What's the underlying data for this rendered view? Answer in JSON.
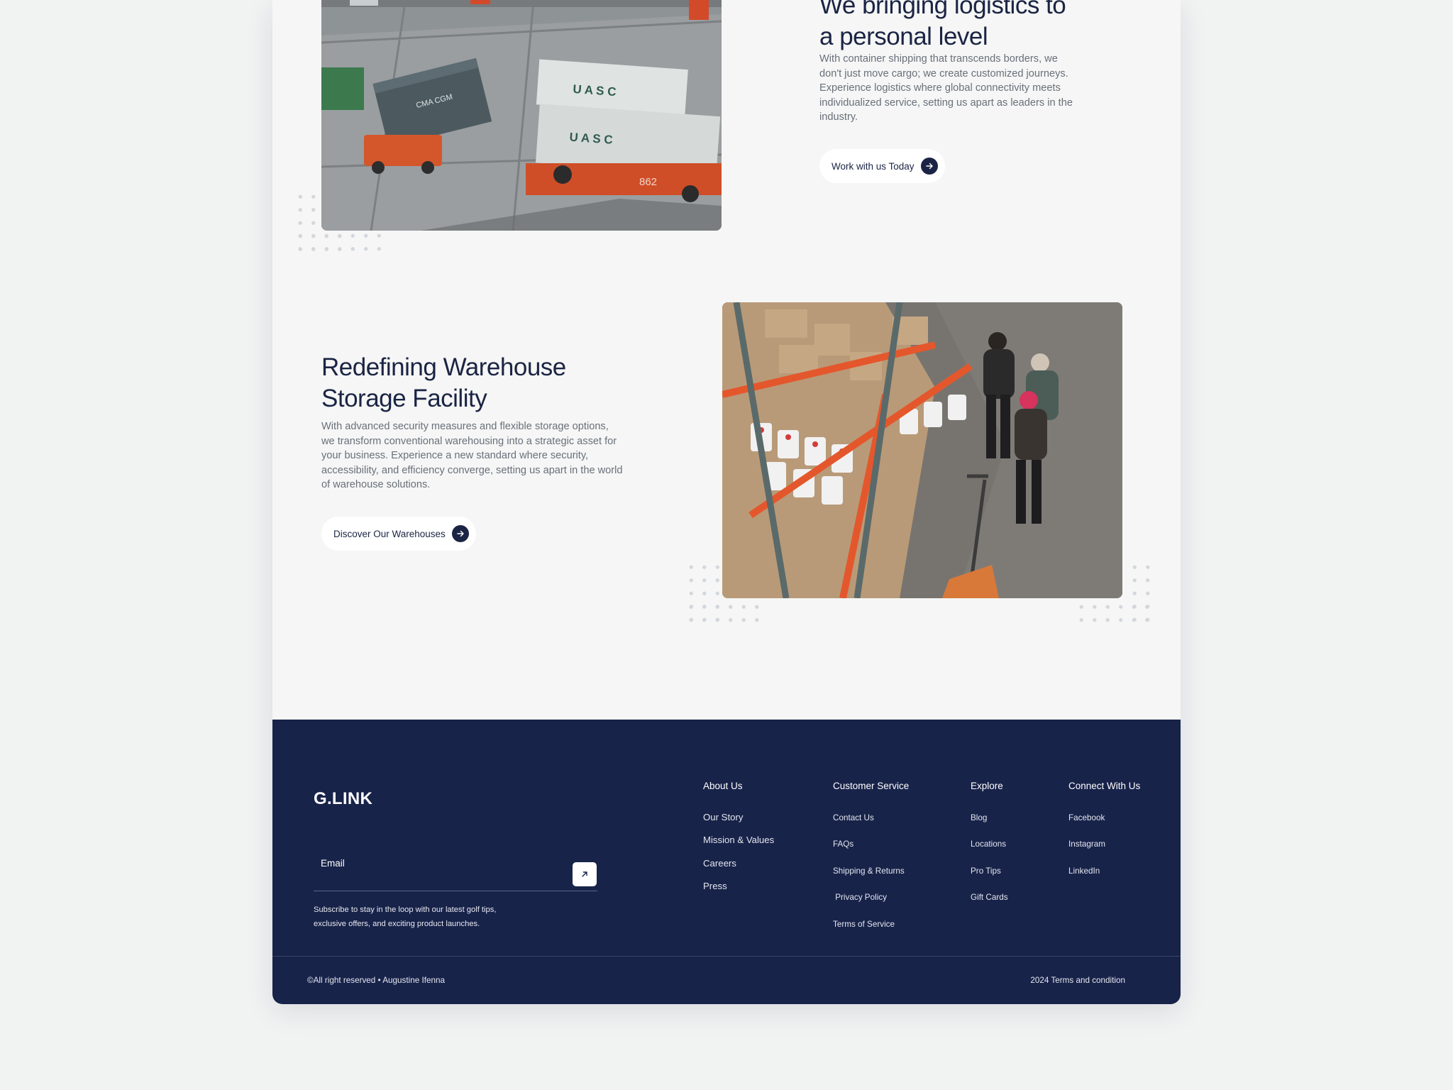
{
  "section_logistics": {
    "heading_line1": "We bringing logistics to",
    "heading_line2": "a personal level",
    "body": "With container shipping that transcends borders, we don't just move cargo; we create customized journeys. Experience logistics where global connectivity meets individualized service, setting us apart as leaders in the industry.",
    "cta_label": "Work with us Today",
    "image": {
      "container_text_1": "U A S C",
      "container_text_2": "U A S C",
      "truck_number": "862"
    }
  },
  "section_warehouse": {
    "heading_line1": "Redefining Warehouse",
    "heading_line2": "Storage Facility",
    "body": "With advanced security measures and flexible storage options, we transform conventional warehousing into a strategic asset for your business. Experience a new standard where security, accessibility, and efficiency converge, setting us apart in the world of warehouse solutions.",
    "cta_label": "Discover Our Warehouses"
  },
  "footer": {
    "logo": "G.LINK",
    "email_placeholder": "Email",
    "subscribe_note": "Subscribe to stay in the loop with our latest golf tips, exclusive offers, and exciting product launches.",
    "columns": [
      {
        "title": "About Us",
        "links": [
          "Our Story",
          "Mission & Values",
          "Careers",
          "Press"
        ]
      },
      {
        "title": "Customer Service",
        "links": [
          "Contact Us",
          "FAQs",
          "Shipping & Returns",
          " Privacy Policy",
          "Terms of Service"
        ]
      },
      {
        "title": "Explore",
        "links": [
          "Blog",
          "Locations",
          "Pro Tips",
          "Gift Cards"
        ]
      },
      {
        "title": "Connect With Us",
        "links": [
          "Facebook",
          "Instagram",
          "LinkedIn"
        ]
      }
    ],
    "copyright": "©All right reserved • Augustine Ifenna",
    "terms": "2024 Terms and condition"
  },
  "icons": {
    "cta_arrow": "arrow-right-icon",
    "email_submit": "arrow-up-right-icon"
  },
  "colors": {
    "page_background": "#f5f6f5",
    "navy": "#18234a",
    "heading": "#1b2444",
    "body_text": "#6a6f7a"
  }
}
